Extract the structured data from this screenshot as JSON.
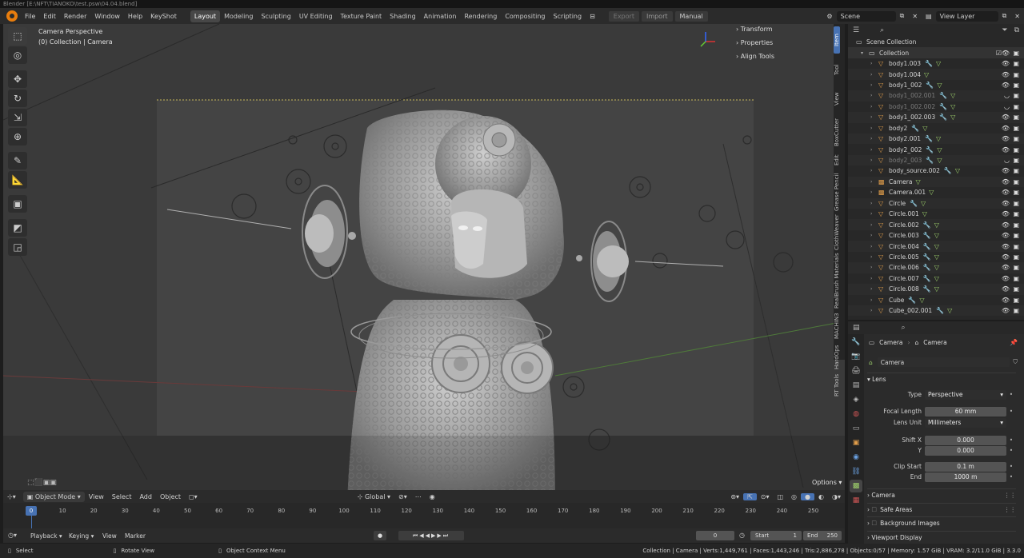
{
  "titlebar": {
    "text": "Blender [E:\\NFT\\TIANOKO\\test.psw\\04.04.blend]"
  },
  "topbar": {
    "menus": [
      "File",
      "Edit",
      "Render",
      "Window",
      "Help",
      "KeyShot"
    ],
    "workspaces": [
      "Layout",
      "Modeling",
      "Sculpting",
      "UV Editing",
      "Texture Paint",
      "Shading",
      "Animation",
      "Rendering",
      "Compositing",
      "Scripting"
    ],
    "active_workspace": "Layout",
    "export_label": "Export",
    "import_label": "Import",
    "manual_label": "Manual",
    "scene_value": "Scene",
    "viewlayer_value": "View Layer"
  },
  "viewport": {
    "view_name": "Camera Perspective",
    "collection_label": "(0) Collection | Camera",
    "npanel": [
      "Transform",
      "Properties",
      "Align Tools"
    ],
    "options_label": "Options"
  },
  "side_tabs": [
    "Item",
    "Tool",
    "View",
    "BoxCutter",
    "Edit",
    "Grease Pencil",
    "ClothWeaver",
    "RealBrush Materials",
    "MACHIN3",
    "HardOps",
    "RT Tools"
  ],
  "outliner": {
    "root": "Scene Collection",
    "collection": "Collection",
    "items": [
      {
        "name": "body1.003",
        "dim": false,
        "type": "mesh",
        "mod": true
      },
      {
        "name": "body1.004",
        "dim": false,
        "type": "mesh",
        "mod": false
      },
      {
        "name": "body1_002",
        "dim": false,
        "type": "mesh",
        "mod": true
      },
      {
        "name": "body1_002.001",
        "dim": true,
        "type": "mesh",
        "mod": true
      },
      {
        "name": "body1_002.002",
        "dim": true,
        "type": "mesh",
        "mod": true
      },
      {
        "name": "body1_002.003",
        "dim": false,
        "type": "mesh",
        "mod": true
      },
      {
        "name": "body2",
        "dim": false,
        "type": "mesh",
        "mod": true
      },
      {
        "name": "body2.001",
        "dim": false,
        "type": "mesh",
        "mod": true
      },
      {
        "name": "body2_002",
        "dim": false,
        "type": "mesh",
        "mod": true
      },
      {
        "name": "body2_003",
        "dim": true,
        "type": "mesh",
        "mod": true
      },
      {
        "name": "body_source.002",
        "dim": false,
        "type": "mesh",
        "mod": true
      },
      {
        "name": "Camera",
        "dim": false,
        "type": "camera",
        "mod": false
      },
      {
        "name": "Camera.001",
        "dim": false,
        "type": "camera",
        "mod": false
      },
      {
        "name": "Circle",
        "dim": false,
        "type": "mesh",
        "mod": true
      },
      {
        "name": "Circle.001",
        "dim": false,
        "type": "mesh",
        "mod": false
      },
      {
        "name": "Circle.002",
        "dim": false,
        "type": "mesh",
        "mod": true
      },
      {
        "name": "Circle.003",
        "dim": false,
        "type": "mesh",
        "mod": true
      },
      {
        "name": "Circle.004",
        "dim": false,
        "type": "mesh",
        "mod": true
      },
      {
        "name": "Circle.005",
        "dim": false,
        "type": "mesh",
        "mod": true
      },
      {
        "name": "Circle.006",
        "dim": false,
        "type": "mesh",
        "mod": true
      },
      {
        "name": "Circle.007",
        "dim": false,
        "type": "mesh",
        "mod": true
      },
      {
        "name": "Circle.008",
        "dim": false,
        "type": "mesh",
        "mod": true
      },
      {
        "name": "Cube",
        "dim": false,
        "type": "mesh",
        "mod": true
      },
      {
        "name": "Cube_002.001",
        "dim": false,
        "type": "mesh",
        "mod": true
      }
    ]
  },
  "properties": {
    "breadcrumb_obj": "Camera",
    "breadcrumb_data": "Camera",
    "data_name": "Camera",
    "lens_panel": "Lens",
    "type_label": "Type",
    "type_value": "Perspective",
    "focal_label": "Focal Length",
    "focal_value": "60 mm",
    "lensunit_label": "Lens Unit",
    "lensunit_value": "Millimeters",
    "shiftx_label": "Shift X",
    "shiftx_value": "0.000",
    "shifty_label": "Y",
    "shifty_value": "0.000",
    "clipstart_label": "Clip Start",
    "clipstart_value": "0.1 m",
    "end_label": "End",
    "end_value": "1000 m",
    "subpanels": [
      "Camera",
      "Safe Areas",
      "Background Images",
      "Viewport Display"
    ]
  },
  "timeline": {
    "mode": "Object Mode",
    "menus": [
      "View",
      "Select",
      "Add",
      "Object"
    ],
    "orientation": "Global",
    "ticks": [
      "0",
      "10",
      "20",
      "30",
      "40",
      "50",
      "60",
      "70",
      "80",
      "90",
      "100",
      "110",
      "120",
      "130",
      "140",
      "150",
      "160",
      "170",
      "180",
      "190",
      "200",
      "210",
      "220",
      "230",
      "240",
      "250"
    ],
    "current_frame": "0",
    "play_menus": [
      "Playback",
      "Keying",
      "View",
      "Marker"
    ],
    "frame_value": "0",
    "start_label": "Start",
    "start_value": "1",
    "end_label": "End",
    "end_value": "250"
  },
  "status": {
    "select": "Select",
    "rotate": "Rotate View",
    "context": "Object Context Menu",
    "stats": "Collection | Camera | Verts:1,449,761 | Faces:1,443,246 | Tris:2,886,278 | Objects:0/57 | Memory: 1.57 GiB | VRAM: 3.2/11.0 GiB | 3.3.0"
  }
}
